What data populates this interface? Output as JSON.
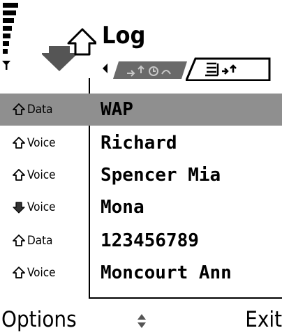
{
  "header": {
    "title": "Log",
    "signal_icon": "signal-strength-icon",
    "app_icon": "log-arrows-icon"
  },
  "tabs": [
    {
      "name": "call-timers-tab",
      "icon": "call-timers-icon",
      "active": false
    },
    {
      "name": "event-log-tab",
      "icon": "event-log-icon",
      "active": true
    }
  ],
  "log": {
    "entries": [
      {
        "direction_icon": "outgoing-arrow-icon",
        "type": "Data",
        "name": "WAP",
        "selected": true
      },
      {
        "direction_icon": "outgoing-arrow-icon",
        "type": "Voice",
        "name": "Richard",
        "selected": false
      },
      {
        "direction_icon": "outgoing-arrow-icon",
        "type": "Voice",
        "name": "Spencer Mia",
        "selected": false
      },
      {
        "direction_icon": "incoming-arrow-icon",
        "type": "Voice",
        "name": "Mona",
        "selected": false
      },
      {
        "direction_icon": "outgoing-arrow-icon",
        "type": "Data",
        "name": "123456789",
        "selected": false
      },
      {
        "direction_icon": "outgoing-arrow-icon",
        "type": "Voice",
        "name": "Moncourt Ann",
        "selected": false
      }
    ]
  },
  "softkeys": {
    "left": "Options",
    "right": "Exit",
    "scroll_icon": "scroll-up-down-icon"
  },
  "colors": {
    "selection": "#8f8f8f",
    "inactive_tab": "#6a6a6a",
    "foreground": "#000000",
    "background": "#ffffff"
  }
}
